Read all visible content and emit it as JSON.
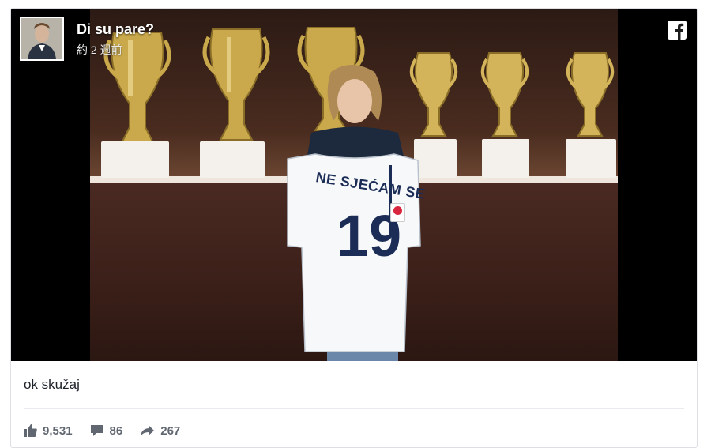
{
  "post": {
    "page_name": "Di su pare?",
    "timestamp": "約 2 週前",
    "caption": "ok skužaj"
  },
  "photo": {
    "jersey_text": "NE SJEĆAM SE",
    "jersey_number": "19"
  },
  "stats": {
    "likes": "9,531",
    "comments": "86",
    "shares": "267"
  },
  "icons": {
    "likes": "thumbs-up-icon",
    "comments": "comment-icon",
    "shares": "share-arrow-icon",
    "platform": "facebook-icon"
  },
  "colors": {
    "page_name": "#ffffff",
    "stat_text": "#616770",
    "caption": "#1d2129"
  }
}
